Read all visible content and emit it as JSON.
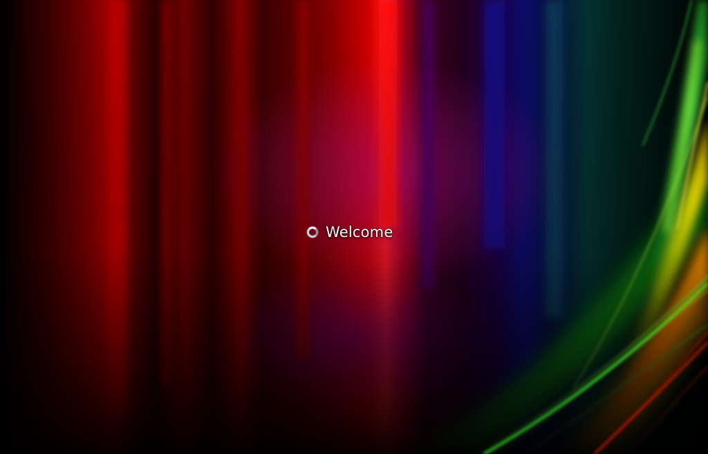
{
  "screen": {
    "type": "windows-logon-welcome"
  },
  "welcome": {
    "status_text": "Welcome",
    "spinner_icon": "busy-spinner-icon"
  },
  "colors": {
    "background": "#000000",
    "text": "#ffffff",
    "wallpaper_red": "#d40000",
    "wallpaper_purple": "#8a00b0",
    "wallpaper_blue": "#1010c0",
    "wallpaper_green": "#1fd11f",
    "wallpaper_yellow": "#f2e600",
    "wallpaper_orange": "#ff7a00"
  }
}
